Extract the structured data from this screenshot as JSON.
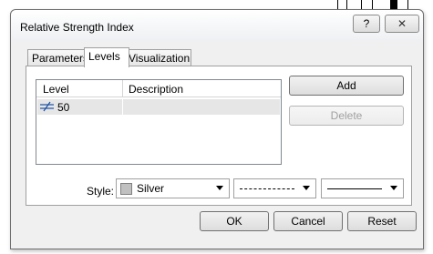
{
  "window": {
    "title": "Relative Strength Index",
    "help_label": "?",
    "close_label": "✕"
  },
  "tabs": [
    {
      "label": "Parameters",
      "active": false
    },
    {
      "label": "Levels",
      "active": true
    },
    {
      "label": "Visualization",
      "active": false
    }
  ],
  "levels_list": {
    "headers": {
      "level": "Level",
      "description": "Description"
    },
    "rows": [
      {
        "level": "50",
        "description": ""
      }
    ]
  },
  "buttons": {
    "add": "Add",
    "delete": "Delete",
    "ok": "OK",
    "cancel": "Cancel",
    "reset": "Reset"
  },
  "style": {
    "label": "Style:",
    "color_name": "Silver",
    "color_hex": "#c0c0c0"
  }
}
